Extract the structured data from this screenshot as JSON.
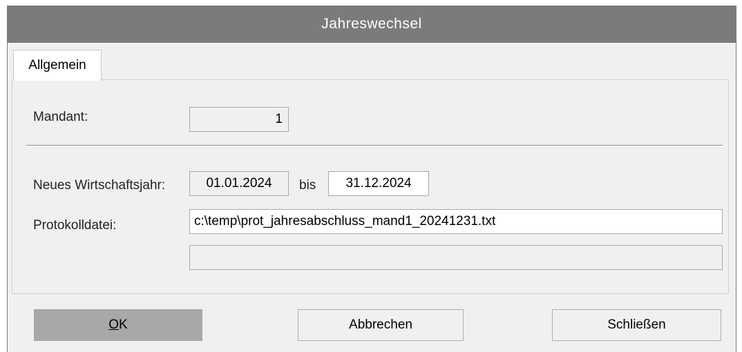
{
  "window": {
    "title": "Jahreswechsel"
  },
  "tabs": [
    {
      "label": "Allgemein",
      "active": true
    }
  ],
  "form": {
    "mandant": {
      "label": "Mandant:",
      "value": "1"
    },
    "wirtschaftsjahr": {
      "label": "Neues Wirtschaftsjahr:",
      "from": "01.01.2024",
      "sep": "bis",
      "to": "31.12.2024"
    },
    "protokoll": {
      "label": "Protokolldatei:",
      "value": "c:\\temp\\prot_jahresabschluss_mand1_20241231.txt"
    },
    "status": {
      "value": ""
    }
  },
  "buttons": {
    "ok": {
      "mnemonic": "O",
      "rest": "K",
      "is_default": true
    },
    "cancel": "Abbrechen",
    "close": "Schließen"
  },
  "colors": {
    "titlebar": "#7b7b7b",
    "dialog_bg": "#f0f0f0",
    "default_button": "#a8a8a8"
  }
}
